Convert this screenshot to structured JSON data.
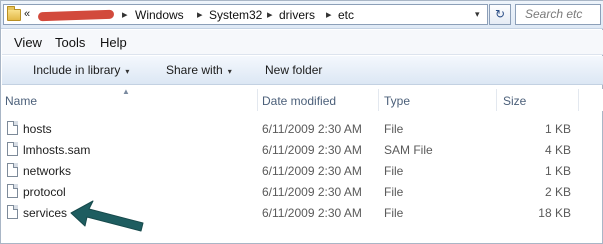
{
  "address_bar": {
    "overflow_glyph": "«",
    "crumbs": [
      "Windows",
      "System32",
      "drivers",
      "etc"
    ],
    "separator": "▸",
    "dropdown_glyph": "▾",
    "refresh_glyph": "↻"
  },
  "search": {
    "placeholder": "Search etc"
  },
  "menu": {
    "items": [
      "View",
      "Tools",
      "Help"
    ]
  },
  "commands": {
    "include_in_library": "Include in library",
    "share_with": "Share with",
    "new_folder": "New folder",
    "caret": "▾"
  },
  "columns": {
    "name": "Name",
    "date_modified": "Date modified",
    "type": "Type",
    "size": "Size",
    "sort_caret": "▲"
  },
  "files": [
    {
      "name": "hosts",
      "date": "6/11/2009 2:30 AM",
      "type": "File",
      "size": "1 KB"
    },
    {
      "name": "lmhosts.sam",
      "date": "6/11/2009 2:30 AM",
      "type": "SAM File",
      "size": "4 KB"
    },
    {
      "name": "networks",
      "date": "6/11/2009 2:30 AM",
      "type": "File",
      "size": "1 KB"
    },
    {
      "name": "protocol",
      "date": "6/11/2009 2:30 AM",
      "type": "File",
      "size": "2 KB"
    },
    {
      "name": "services",
      "date": "6/11/2009 2:30 AM",
      "type": "File",
      "size": "18 KB"
    }
  ],
  "colors": {
    "accent_arrow": "#1e5d60",
    "redaction": "#d24a3c"
  },
  "icons": [
    "folder-icon",
    "refresh-icon",
    "file-icon",
    "arrow-annotation"
  ]
}
